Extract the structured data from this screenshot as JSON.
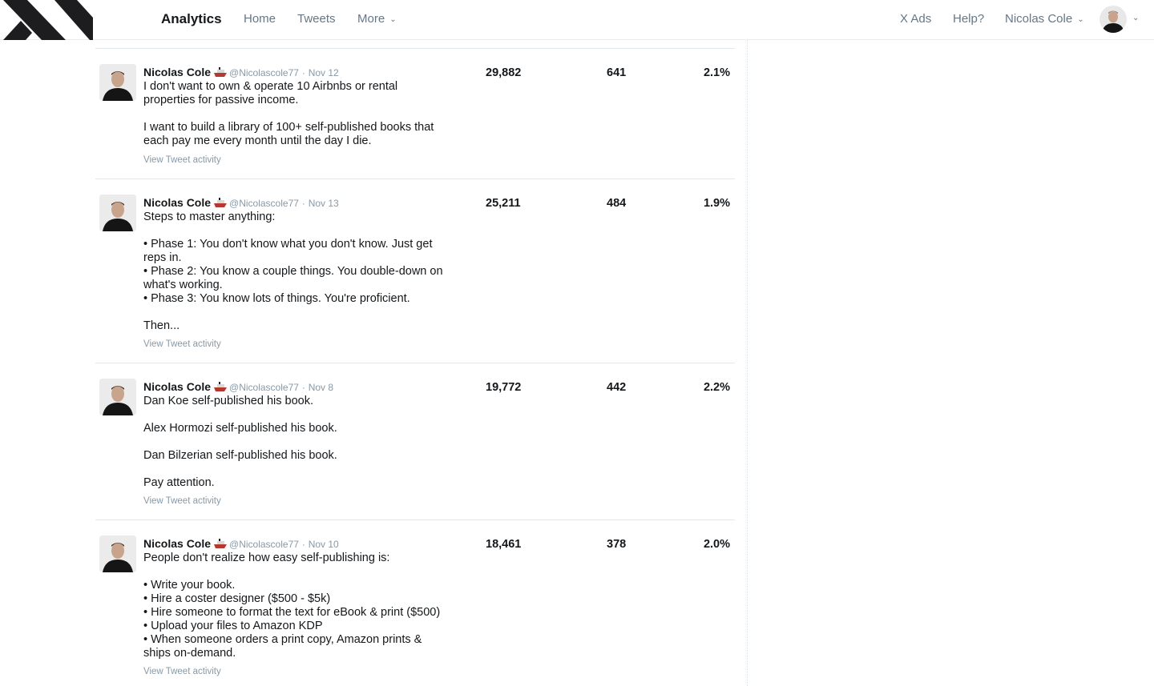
{
  "nav": {
    "title": "Analytics",
    "home": "Home",
    "tweets": "Tweets",
    "more": "More",
    "x_ads": "X Ads",
    "help": "Help?",
    "user": "Nicolas Cole",
    "logo_icon": "x-logo-icon",
    "chevron_icon": "chevron-down-icon"
  },
  "colors": {
    "text": "#14171a",
    "muted": "#657786",
    "light": "#8899a6",
    "divider": "#e1e8ed"
  },
  "tweets": [
    {
      "author": "Nicolas Cole",
      "handle": "@Nicolascole77",
      "separator": "·",
      "date": "Nov 12",
      "lines": [
        "I don't want to own & operate 10 Airbnbs or rental",
        "properties for passive income.",
        "",
        "I want to build a library of 100+ self-published books that",
        "each pay me every month until the day I die."
      ],
      "activity": "View Tweet activity",
      "impressions": "29,882",
      "engagements": "641",
      "engagement_rate": "2.1%"
    },
    {
      "author": "Nicolas Cole",
      "handle": "@Nicolascole77",
      "separator": "·",
      "date": "Nov 13",
      "lines": [
        "Steps to master anything:",
        "",
        "• Phase 1: You don't know what you don't know. Just get",
        "reps in.",
        "• Phase 2: You know a couple things. You double-down on",
        "what's working.",
        "• Phase 3: You know lots of things. You're proficient.",
        "",
        "Then..."
      ],
      "activity": "View Tweet activity",
      "impressions": "25,211",
      "engagements": "484",
      "engagement_rate": "1.9%"
    },
    {
      "author": "Nicolas Cole",
      "handle": "@Nicolascole77",
      "separator": "·",
      "date": "Nov 8",
      "lines": [
        "Dan Koe self-published his book.",
        "",
        "Alex Hormozi self-published his book.",
        "",
        "Dan Bilzerian self-published his book.",
        "",
        "Pay attention."
      ],
      "activity": "View Tweet activity",
      "impressions": "19,772",
      "engagements": "442",
      "engagement_rate": "2.2%"
    },
    {
      "author": "Nicolas Cole",
      "handle": "@Nicolascole77",
      "separator": "·",
      "date": "Nov 10",
      "lines": [
        "People don't realize how easy self-publishing is:",
        "",
        "• Write your book.",
        "• Hire a coster designer ($500 - $5k)",
        "• Hire someone to format the text for eBook & print ($500)",
        "• Upload your files to Amazon KDP",
        "• When someone orders a print copy, Amazon prints &",
        "ships on-demand."
      ],
      "activity": "View Tweet activity",
      "impressions": "18,461",
      "engagements": "378",
      "engagement_rate": "2.0%"
    }
  ]
}
